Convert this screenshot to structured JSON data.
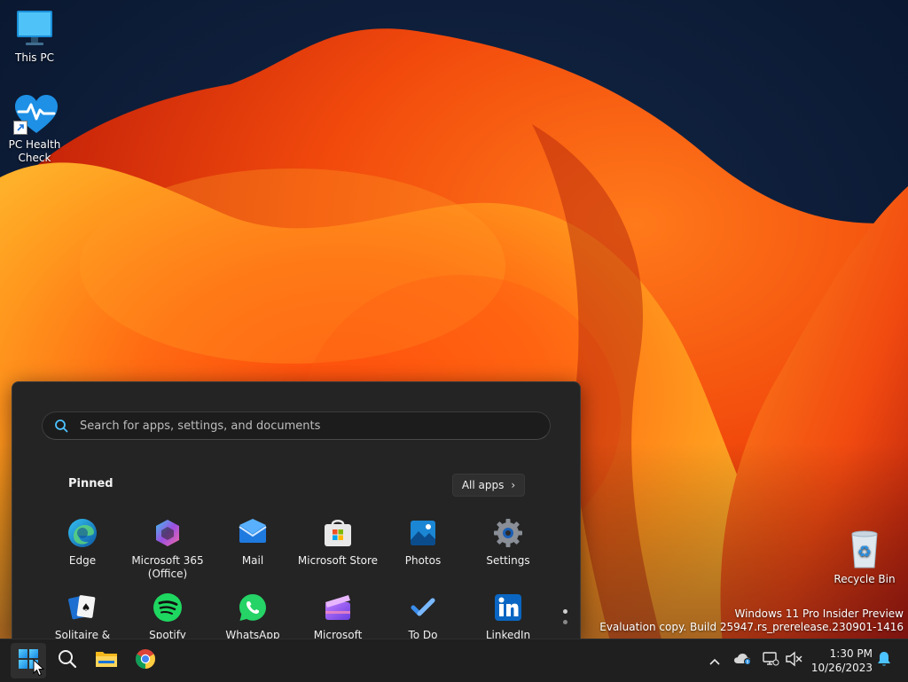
{
  "desktop": {
    "icons": [
      {
        "label": "This PC"
      },
      {
        "label": "PC Health\nCheck"
      },
      {
        "label": "Recycle Bin"
      }
    ],
    "watermark": {
      "line1": "Windows 11 Pro Insider Preview",
      "line2": "Evaluation copy. Build 25947.rs_prerelease.230901-1416"
    }
  },
  "start_menu": {
    "search": {
      "placeholder": "Search for apps, settings, and documents",
      "value": ""
    },
    "pinned_label": "Pinned",
    "all_apps_label": "All apps",
    "pinned": [
      {
        "label": "Edge",
        "icon": "edge-icon"
      },
      {
        "label": "Microsoft 365\n(Office)",
        "icon": "microsoft-365-icon"
      },
      {
        "label": "Mail",
        "icon": "mail-icon"
      },
      {
        "label": "Microsoft Store",
        "icon": "microsoft-store-icon"
      },
      {
        "label": "Photos",
        "icon": "photos-icon"
      },
      {
        "label": "Settings",
        "icon": "settings-gear-icon"
      },
      {
        "label": "Solitaire &",
        "icon": "solitaire-icon"
      },
      {
        "label": "Spotify",
        "icon": "spotify-icon"
      },
      {
        "label": "WhatsApp",
        "icon": "whatsapp-icon"
      },
      {
        "label": "Microsoft",
        "icon": "clipchamp-icon"
      },
      {
        "label": "To Do",
        "icon": "todo-icon"
      },
      {
        "label": "LinkedIn",
        "icon": "linkedin-icon"
      }
    ]
  },
  "taskbar": {
    "apps": [
      "start-icon",
      "search-icon",
      "file-explorer-icon",
      "chrome-icon"
    ],
    "clock": {
      "time": "1:30 PM",
      "date": "10/26/2023"
    }
  },
  "colors": {
    "accent": "#4cc2ff",
    "start_bg": "#242424",
    "taskbar_bg": "#1f1f1f"
  }
}
